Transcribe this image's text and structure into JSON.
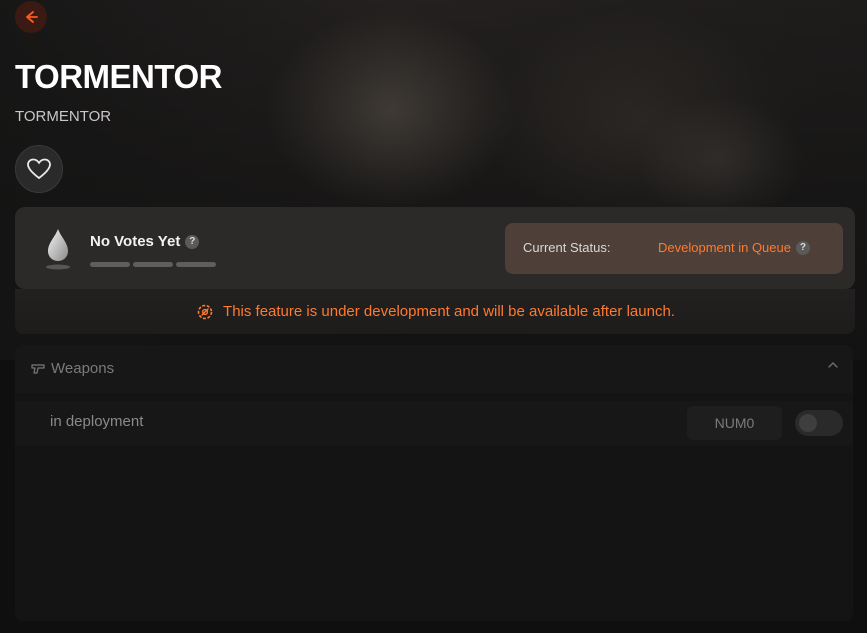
{
  "header": {
    "title": "TORMENTOR",
    "subtitle": "TORMENTOR",
    "back_icon": "arrow-left-icon",
    "favorite_icon": "heart-icon"
  },
  "votes": {
    "label": "No Votes Yet",
    "help": "?",
    "icon": "droplet-icon"
  },
  "status": {
    "label": "Current Status:",
    "value": "Development in Queue",
    "help": "?"
  },
  "notice": {
    "text": "This feature is under development and will be available after launch.",
    "icon": "gear-wrench-icon"
  },
  "section": {
    "title": "Weapons",
    "icon": "pistol-icon",
    "chevron": "chevron-up-icon",
    "rows": [
      {
        "label": "in deployment",
        "key": "NUM0",
        "enabled": false
      }
    ]
  },
  "colors": {
    "accent": "#ff7a2e",
    "background": "#0f0f0f",
    "status_box": "#4e3f38"
  }
}
